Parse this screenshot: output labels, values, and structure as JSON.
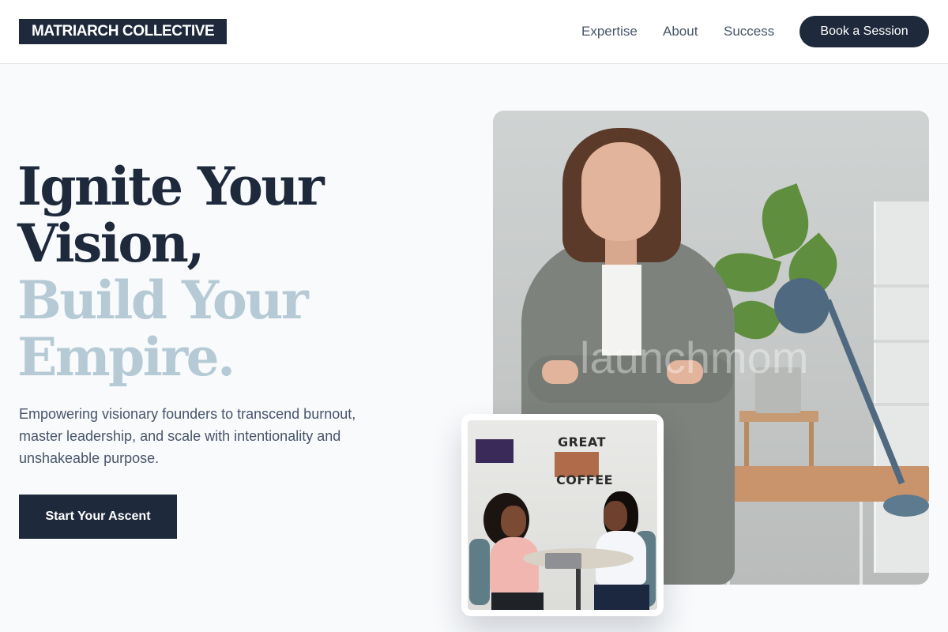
{
  "header": {
    "logo": "MATRIARCH COLLECTIVE",
    "nav": [
      {
        "label": "Expertise"
      },
      {
        "label": "About"
      },
      {
        "label": "Success"
      }
    ],
    "cta_label": "Book a Session"
  },
  "hero": {
    "headline_dark_line1": "Ignite Your",
    "headline_dark_line2": "Vision,",
    "headline_light_line1": "Build Your",
    "headline_light_line2": "Empire.",
    "subtext": "Empowering visionary founders to transcend burnout, master leadership, and scale with intentionality and unshakeable purpose.",
    "cta_label": "Start Your Ascent"
  },
  "images": {
    "main_photo_watermark": "launchmom",
    "card_photo_sign_line1": "GREAT",
    "card_photo_sign_line2": "COFFEE"
  },
  "colors": {
    "primary": "#1e293b",
    "accent_light": "#b5cad4",
    "background": "#f8fafc",
    "body_text": "#475569"
  }
}
